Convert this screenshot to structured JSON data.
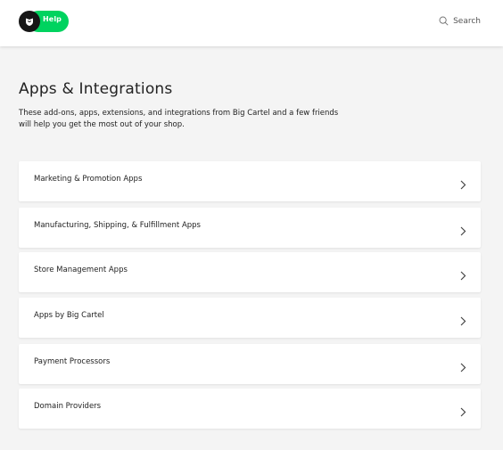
{
  "header": {
    "logo_label": "Help",
    "search_label": "Search"
  },
  "main": {
    "title": "Apps & Integrations",
    "intro": "These add-ons, apps, extensions, and integrations from Big Cartel and a few friends will help you get the most out of your shop.",
    "categories": [
      {
        "label": "Marketing & Promotion Apps"
      },
      {
        "label": "Manufacturing, Shipping, & Fulfillment Apps"
      },
      {
        "label": "Store Management Apps"
      },
      {
        "label": "Apps by Big Cartel"
      },
      {
        "label": "Payment Processors"
      },
      {
        "label": "Domain Providers"
      }
    ]
  },
  "colors": {
    "accent": "#00d35f",
    "badge": "#161616",
    "background": "#f4f4f4",
    "card": "#ffffff"
  },
  "icons": {
    "logo": "big-cartel-logo-icon",
    "search": "search-icon",
    "chevron": "chevron-right-icon"
  }
}
